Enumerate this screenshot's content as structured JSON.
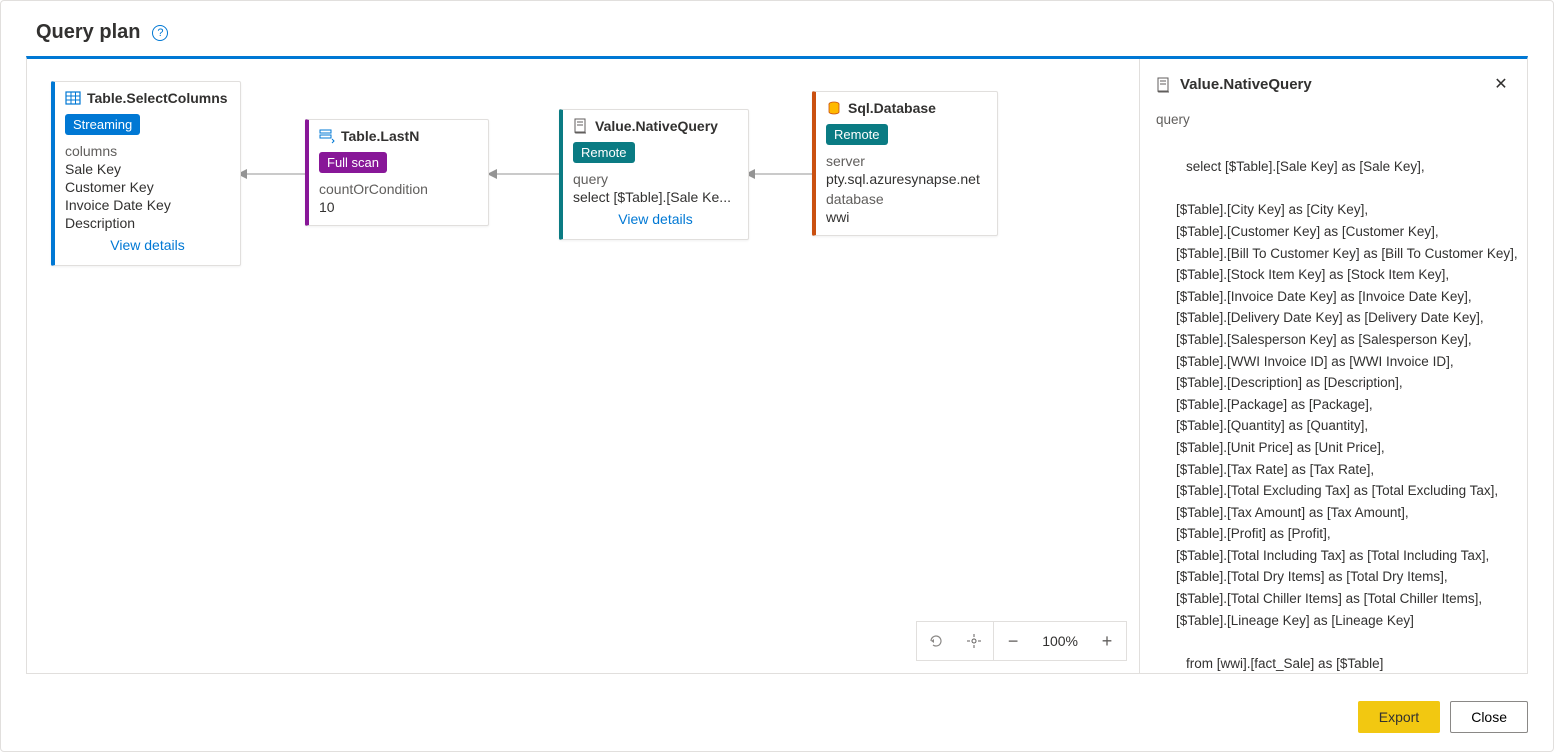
{
  "header": {
    "title": "Query plan"
  },
  "nodes": {
    "selectColumns": {
      "title": "Table.SelectColumns",
      "badge": "Streaming",
      "labelColumns": "columns",
      "col1": "Sale Key",
      "col2": "Customer Key",
      "col3": "Invoice Date Key",
      "col4": "Description",
      "viewDetails": "View details"
    },
    "lastN": {
      "title": "Table.LastN",
      "badge": "Full scan",
      "labelCond": "countOrCondition",
      "valCond": "10"
    },
    "nativeQuery": {
      "title": "Value.NativeQuery",
      "badge": "Remote",
      "labelQuery": "query",
      "valQuery": "select [$Table].[Sale Ke...",
      "viewDetails": "View details"
    },
    "sqlDatabase": {
      "title": "Sql.Database",
      "badge": "Remote",
      "labelServer": "server",
      "valServer": "pty.sql.azuresynapse.net",
      "labelDb": "database",
      "valDb": "wwi"
    }
  },
  "details": {
    "title": "Value.NativeQuery",
    "labelQuery": "query",
    "sqlLine0": "select [$Table].[Sale Key] as [Sale Key],",
    "sqlLines": [
      "[$Table].[City Key] as [City Key],",
      "[$Table].[Customer Key] as [Customer Key],",
      "[$Table].[Bill To Customer Key] as [Bill To Customer Key],",
      "[$Table].[Stock Item Key] as [Stock Item Key],",
      "[$Table].[Invoice Date Key] as [Invoice Date Key],",
      "[$Table].[Delivery Date Key] as [Delivery Date Key],",
      "[$Table].[Salesperson Key] as [Salesperson Key],",
      "[$Table].[WWI Invoice ID] as [WWI Invoice ID],",
      "[$Table].[Description] as [Description],",
      "[$Table].[Package] as [Package],",
      "[$Table].[Quantity] as [Quantity],",
      "[$Table].[Unit Price] as [Unit Price],",
      "[$Table].[Tax Rate] as [Tax Rate],",
      "[$Table].[Total Excluding Tax] as [Total Excluding Tax],",
      "[$Table].[Tax Amount] as [Tax Amount],",
      "[$Table].[Profit] as [Profit],",
      "[$Table].[Total Including Tax] as [Total Including Tax],",
      "[$Table].[Total Dry Items] as [Total Dry Items],",
      "[$Table].[Total Chiller Items] as [Total Chiller Items],",
      "[$Table].[Lineage Key] as [Lineage Key]"
    ],
    "sqlFrom": "from [wwi].[fact_Sale] as [$Table]"
  },
  "zoom": {
    "value": "100%"
  },
  "footer": {
    "export": "Export",
    "close": "Close"
  }
}
